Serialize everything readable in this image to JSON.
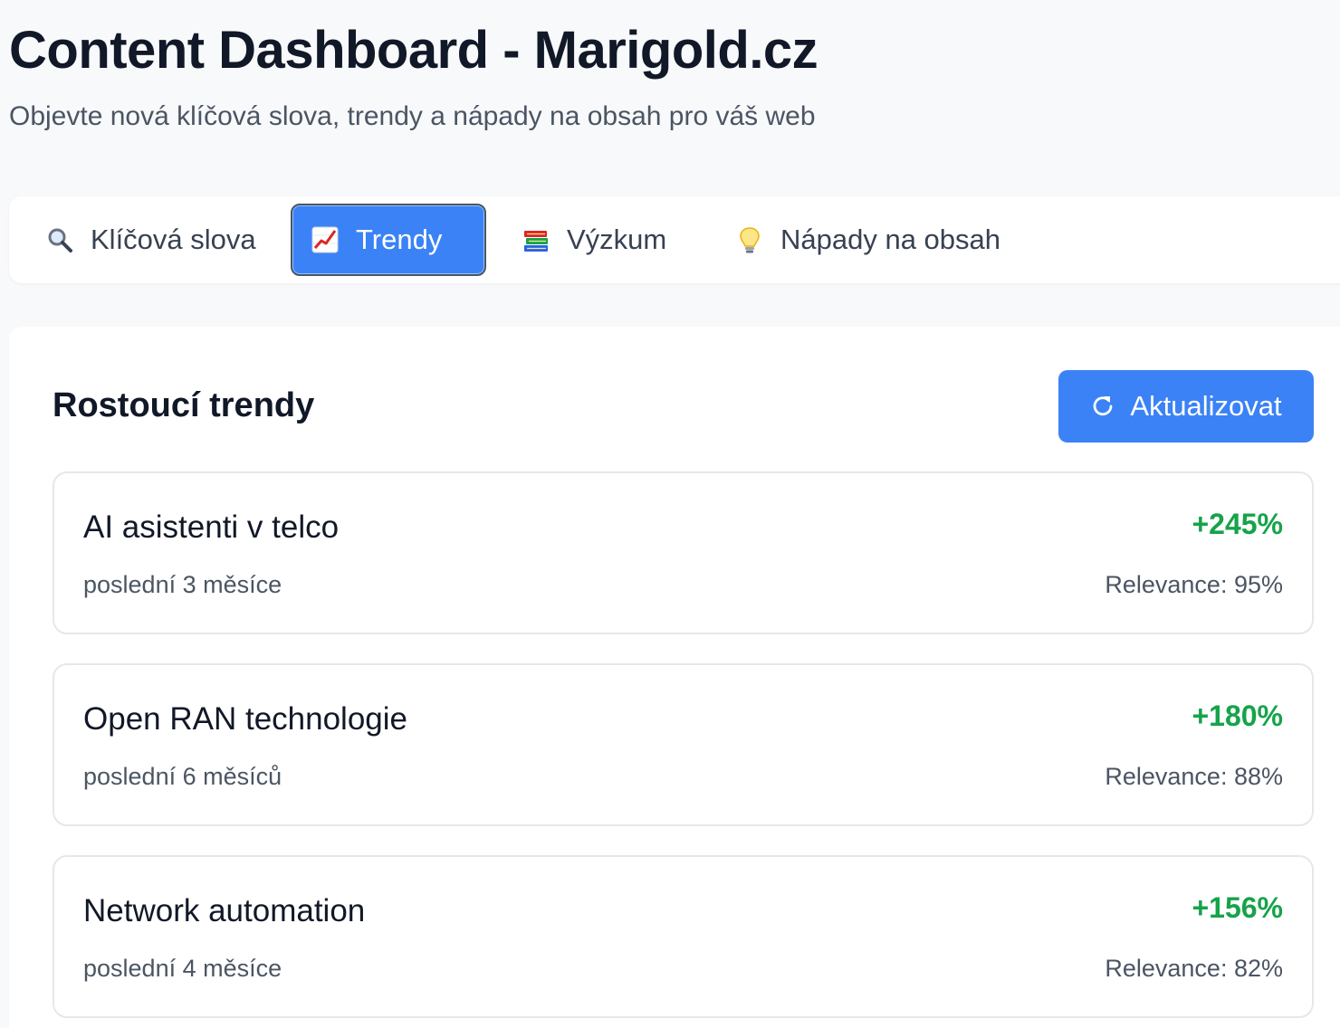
{
  "header": {
    "title": "Content Dashboard - Marigold.cz",
    "subtitle": "Objevte nová klíčová slova, trendy a nápady na obsah pro váš web"
  },
  "tabs": [
    {
      "label": "Klíčová slova",
      "icon": "magnifier-icon",
      "active": false
    },
    {
      "label": "Trendy",
      "icon": "chart-increasing-icon",
      "active": true
    },
    {
      "label": "Výzkum",
      "icon": "books-icon",
      "active": false
    },
    {
      "label": "Nápady na obsah",
      "icon": "lightbulb-icon",
      "active": false
    }
  ],
  "trends": {
    "title": "Rostoucí trendy",
    "refresh_label": "Aktualizovat",
    "refresh_icon": "refresh-icon",
    "items": [
      {
        "name": "AI asistenti v telco",
        "period": "poslední 3 měsíce",
        "growth": "+245%",
        "relevance": "Relevance: 95%"
      },
      {
        "name": "Open RAN technologie",
        "period": "poslední 6 měsíců",
        "growth": "+180%",
        "relevance": "Relevance: 88%"
      },
      {
        "name": "Network automation",
        "period": "poslední 4 měsíce",
        "growth": "+156%",
        "relevance": "Relevance: 82%"
      }
    ]
  },
  "colors": {
    "accent": "#3b82f6",
    "growth": "#16a34a",
    "background": "#f8f9fb"
  }
}
